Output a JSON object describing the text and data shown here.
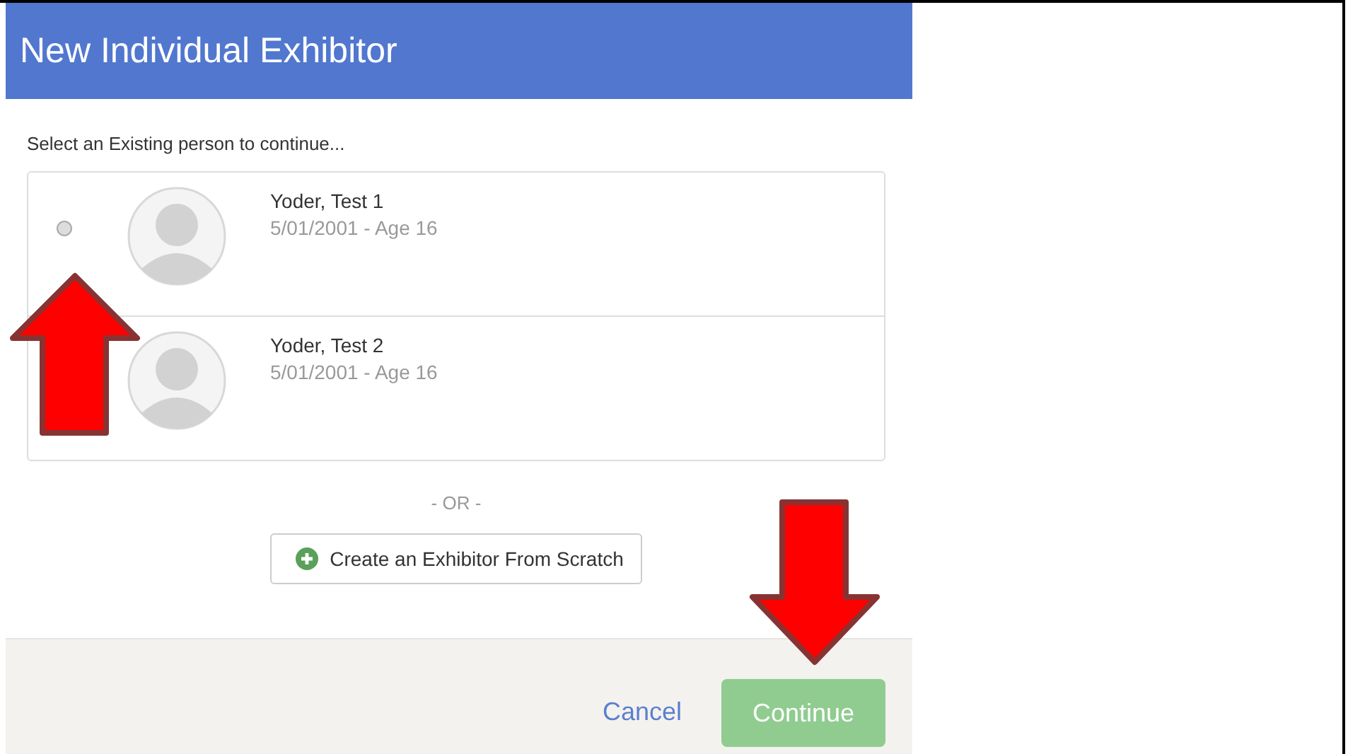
{
  "dialog": {
    "title": "New Individual Exhibitor",
    "prompt": "Select an Existing person to continue...",
    "people": [
      {
        "name": "Yoder, Test 1",
        "details": "5/01/2001 - Age 16",
        "selected": false
      },
      {
        "name": "Yoder, Test 2",
        "details": "5/01/2001 - Age 16"
      }
    ],
    "separator": "- OR -",
    "create_button": "Create an Exhibitor From Scratch",
    "footer": {
      "cancel": "Cancel",
      "continue": {
        "label": "Continue",
        "disabled": true
      }
    }
  }
}
